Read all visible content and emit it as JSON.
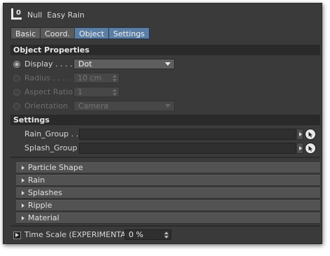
{
  "title": {
    "icon_letter": "L",
    "icon_number": "0",
    "text": "Null  Easy Rain"
  },
  "tabs": [
    {
      "label": "Basic",
      "active": false
    },
    {
      "label": "Coord.",
      "active": false
    },
    {
      "label": "Object",
      "active": true
    },
    {
      "label": "Settings",
      "active": true
    }
  ],
  "object_properties": {
    "header": "Object Properties",
    "display": {
      "label": "Display . . . .",
      "value": "Dot"
    },
    "radius": {
      "label": "Radius . . . .",
      "value": "10 cm"
    },
    "aspect_ratio": {
      "label": "Aspect Ratio",
      "value": "1"
    },
    "orientation": {
      "label": "Orientation",
      "value": "Camera"
    }
  },
  "settings": {
    "header": "Settings",
    "rain_group": {
      "label": "Rain_Group . .",
      "value": ""
    },
    "splash_group": {
      "label": "Splash_Group",
      "value": ""
    }
  },
  "groups": [
    "Particle Shape",
    "Rain",
    "Splashes",
    "Ripple",
    "Material"
  ],
  "time_scale": {
    "label": "Time Scale (EXPERIMENTAL)",
    "value": "0 %"
  },
  "colors": {
    "panel_bg": "#3a3a3a",
    "active_tab": "#5b7ea5",
    "header_bg": "#2a2a2a"
  },
  "icons": {
    "title": "null-object-icon",
    "picker": "pick-object-icon",
    "expand": "triangle-right-icon",
    "animate": "keyframe-icon"
  }
}
